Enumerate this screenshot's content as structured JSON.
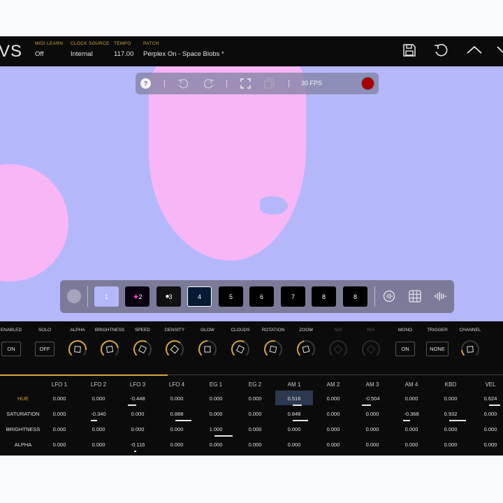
{
  "app": {
    "logo": "VS"
  },
  "header": {
    "fields": [
      {
        "label": "MIDI LEARN",
        "value": "Off"
      },
      {
        "label": "CLOCK SOURCE",
        "value": "Internal"
      },
      {
        "label": "TEMPO",
        "value": "117.00"
      },
      {
        "label": "PATCH",
        "value": "Perplex On - Space Blobs *"
      }
    ],
    "icons": [
      "save-icon",
      "revert-icon",
      "collapse-up-icon",
      "chevron-down-icon"
    ]
  },
  "stage_toolbar": {
    "icons": [
      "help-icon",
      "undo-icon",
      "redo-icon",
      "fullscreen-icon",
      "copy-icon"
    ],
    "fps": "30 FPS",
    "record_color": "#a80000"
  },
  "presets": {
    "slots": [
      "1",
      "2",
      "3",
      "4",
      "5",
      "6",
      "7",
      "8"
    ],
    "selected": "4",
    "icons": [
      "audio-icon",
      "grid-icon",
      "waveform-icon"
    ]
  },
  "controls": [
    {
      "label": "ENABLED",
      "type": "button",
      "value": "ON"
    },
    {
      "label": "SOLO",
      "type": "button",
      "value": "OFF"
    },
    {
      "label": "ALPHA",
      "type": "knob",
      "level": 0.85
    },
    {
      "label": "BRIGHTNESS",
      "type": "knob",
      "level": 0.8
    },
    {
      "label": "SPEED",
      "type": "knob",
      "level": 0.6
    },
    {
      "label": "DENSITY",
      "type": "knob",
      "level": 0.65
    },
    {
      "label": "GLOW",
      "type": "knob",
      "level": 0.5
    },
    {
      "label": "CLOUDS",
      "type": "knob",
      "level": 0.6
    },
    {
      "label": "ROTATION",
      "type": "knob",
      "level": 0.55
    },
    {
      "label": "ZOOM",
      "type": "knob",
      "level": 0.45
    },
    {
      "label": "N/A",
      "type": "knob-disabled"
    },
    {
      "label": "N/A",
      "type": "knob-disabled"
    },
    {
      "label": "MONO",
      "type": "button",
      "value": "ON"
    },
    {
      "label": "TRIGGER",
      "type": "button",
      "value": "NONE"
    },
    {
      "label": "CHANNEL",
      "type": "knob",
      "level": 0.15
    }
  ],
  "matrix": {
    "columns": [
      "LFO 1",
      "LFO 2",
      "LFO 3",
      "LFO 4",
      "EG 1",
      "EG 2",
      "AM 1",
      "AM 2",
      "AM 3",
      "AM 4",
      "KBD",
      "VEL"
    ],
    "rows": [
      {
        "label": "HUE",
        "values": [
          "0.000",
          "0.000",
          "-0.448",
          "0.000",
          "0.000",
          "0.000",
          "0.516",
          "0.000",
          "-0.504",
          "0.000",
          "0.000",
          "0.624"
        ]
      },
      {
        "label": "SATURATION",
        "values": [
          "0.000",
          "-0.340",
          "0.000",
          "0.888",
          "0.000",
          "0.000",
          "0.848",
          "0.000",
          "0.000",
          "-0.368",
          "0.932",
          "0.000"
        ]
      },
      {
        "label": "BRIGHTNESS",
        "values": [
          "0.000",
          "0.000",
          "0.000",
          "0.000",
          "1.000",
          "0.000",
          "0.000",
          "0.000",
          "0.000",
          "0.000",
          "0.000",
          "0.000"
        ]
      },
      {
        "label": "ALPHA",
        "values": [
          "0.000",
          "0.000",
          "-0.116",
          "0.000",
          "0.000",
          "0.000",
          "0.000",
          "0.000",
          "0.000",
          "0.000",
          "0.000",
          "0.000"
        ]
      }
    ],
    "highlighted_cell": {
      "row": 0,
      "col": 6
    },
    "accent_color": "#d4a63a"
  }
}
